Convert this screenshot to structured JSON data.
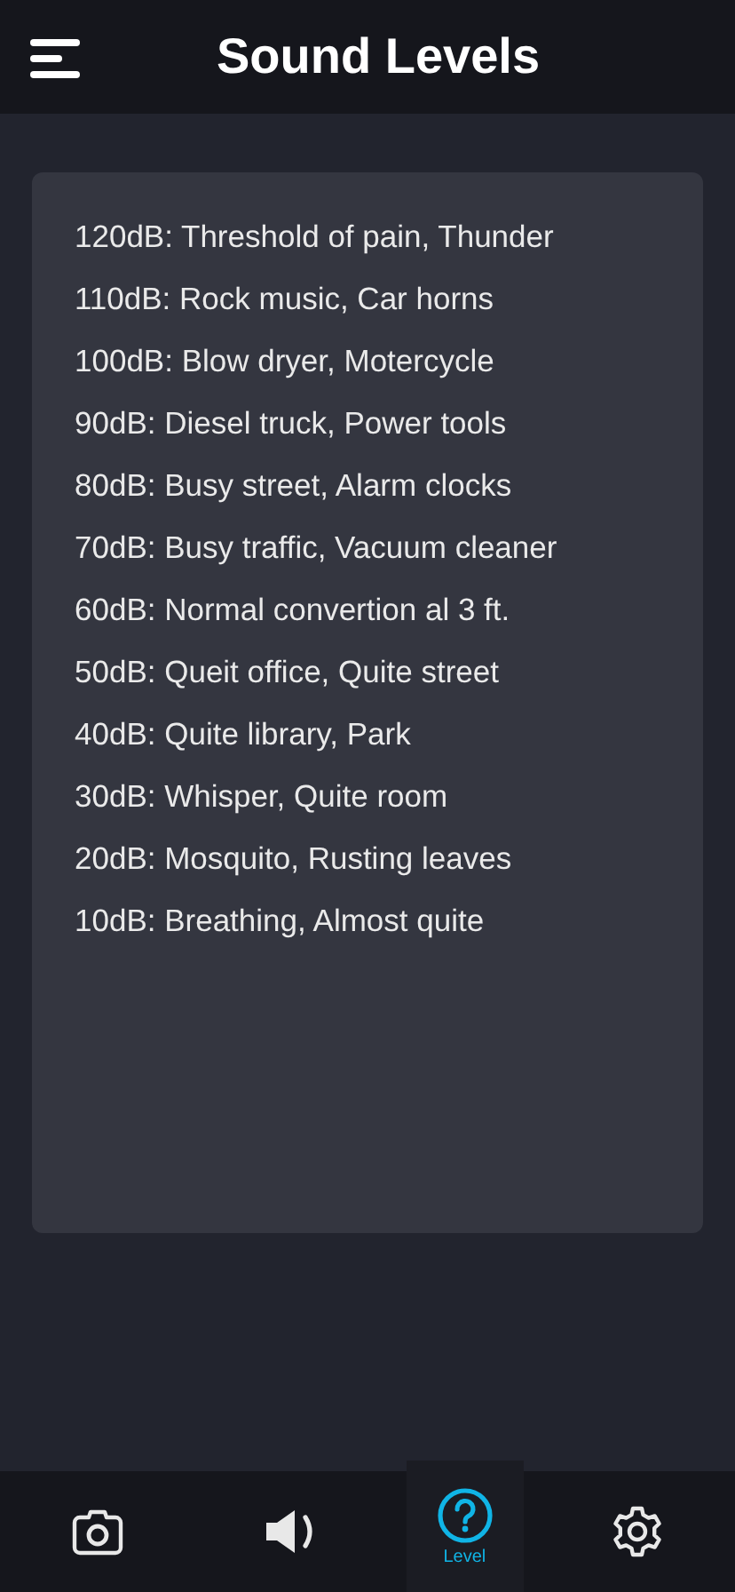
{
  "header": {
    "title": "Sound Levels"
  },
  "levels": [
    "120dB: Threshold of pain, Thunder",
    "110dB: Rock music, Car horns",
    "100dB: Blow dryer, Motercycle",
    "90dB: Diesel truck, Power tools",
    "80dB: Busy street, Alarm clocks",
    "70dB: Busy traffic, Vacuum cleaner",
    "60dB: Normal convertion al 3 ft.",
    "50dB: Queit office, Quite street",
    "40dB: Quite library, Park",
    "30dB: Whisper, Quite room",
    "20dB: Mosquito, Rusting leaves",
    "10dB: Breathing, Almost quite"
  ],
  "nav": [
    {
      "kind": "camera",
      "selected": false
    },
    {
      "kind": "speaker",
      "selected": false
    },
    {
      "kind": "help",
      "selected": true,
      "label": "Level"
    },
    {
      "kind": "gear",
      "selected": false
    }
  ]
}
